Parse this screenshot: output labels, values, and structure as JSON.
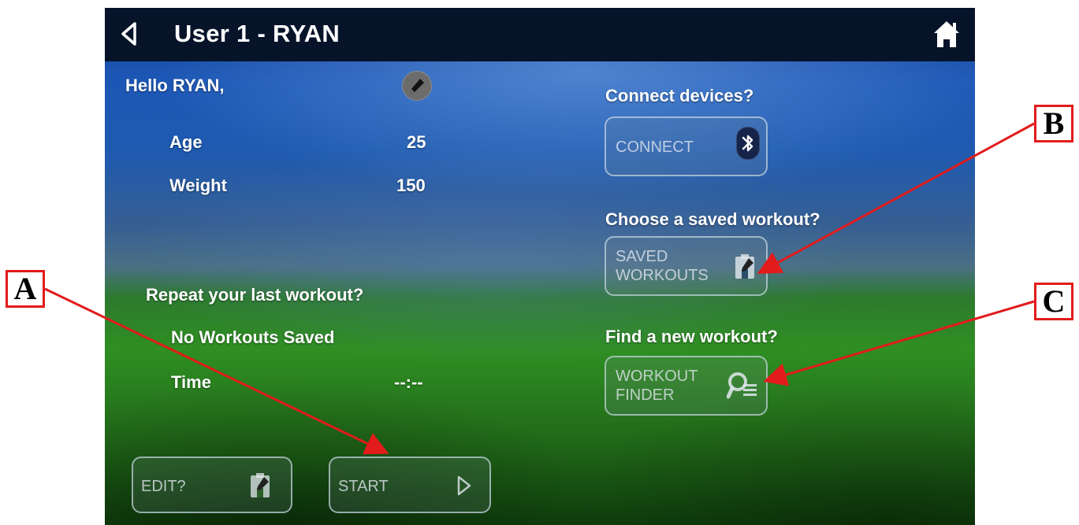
{
  "header": {
    "title": "User 1 - RYAN"
  },
  "profile": {
    "greeting": "Hello RYAN,",
    "age_label": "Age",
    "age_value": "25",
    "weight_label": "Weight",
    "weight_value": "150"
  },
  "last_workout": {
    "heading": "Repeat your last workout?",
    "status": "No Workouts Saved",
    "time_label": "Time",
    "time_value": "--:--"
  },
  "buttons": {
    "edit": "EDIT?",
    "start": "START"
  },
  "connect": {
    "heading": "Connect devices?",
    "button": "CONNECT"
  },
  "saved": {
    "heading": "Choose a saved workout?",
    "button_line1": "SAVED",
    "button_line2": "WORKOUTS"
  },
  "finder": {
    "heading": "Find a new workout?",
    "button_line1": "WORKOUT",
    "button_line2": "FINDER"
  },
  "callouts": {
    "a": "A",
    "b": "B",
    "c": "C"
  },
  "icons": {
    "back": "back-triangle-icon",
    "home": "home-icon",
    "pencil": "pencil-icon",
    "bluetooth": "bluetooth-icon",
    "saved": "saved-workouts-icon",
    "finder": "search-list-icon",
    "edit": "edit-workout-icon",
    "start": "play-triangle-icon"
  },
  "colors": {
    "header_bg": "#061329",
    "callout_red": "#e21b1b"
  }
}
